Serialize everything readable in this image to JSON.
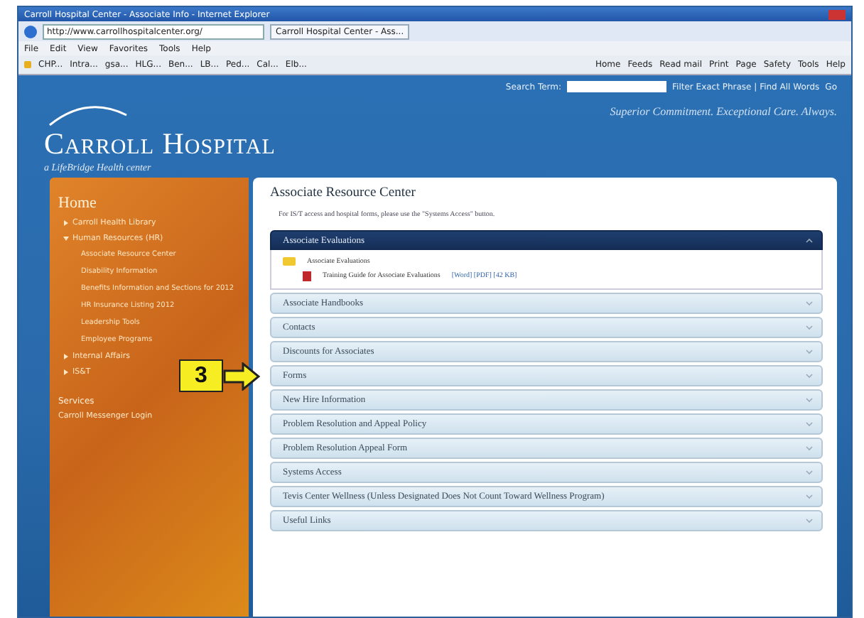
{
  "browser": {
    "title": "Carroll Hospital Center - Associate Info - Internet Explorer",
    "address": "http://www.carrollhospitalcenter.org/",
    "tab": "Carroll Hospital Center - Ass...",
    "menu": [
      "File",
      "Edit",
      "View",
      "Favorites",
      "Tools",
      "Help"
    ],
    "favorites": [
      "CHP...",
      "Intra...",
      "gsa...",
      "HLG...",
      "Ben...",
      "LB...",
      "Ped...",
      "Cal...",
      "Elb..."
    ],
    "commands": [
      "Home",
      "Feeds",
      "Read mail",
      "Print",
      "Page",
      "Safety",
      "Tools",
      "Help"
    ]
  },
  "header": {
    "search_label": "Search Term:",
    "search_options": "Filter Exact Phrase | Find All Words",
    "go": "Go",
    "logo": "Carroll Hospital",
    "logo_sub": "a LifeBridge Health center",
    "tagline": "Superior Commitment. Exceptional Care. Always."
  },
  "sidebar": {
    "title": "Home",
    "items": [
      {
        "label": "Carroll Health Library",
        "expanded": false
      },
      {
        "label": "Human Resources (HR)",
        "expanded": true,
        "children": [
          {
            "label": "Associate Resource Center"
          },
          {
            "label": "Disability Information"
          },
          {
            "label": "Benefits Information and Sections for 2012"
          },
          {
            "label": "HR Insurance Listing 2012"
          },
          {
            "label": "Leadership Tools"
          },
          {
            "label": "Employee Programs"
          }
        ]
      },
      {
        "label": "Internal Affairs",
        "expanded": false
      },
      {
        "label": "IS&T",
        "expanded": false
      }
    ],
    "section": "Services",
    "link": "Carroll Messenger Login"
  },
  "content": {
    "title": "Associate Resource Center",
    "note": "For IS/T access and hospital forms, please use the \"Systems Access\" button.",
    "sections": [
      {
        "title": "Associate Evaluations",
        "expanded": true,
        "folder": "Associate Evaluations",
        "file": "Training Guide for Associate Evaluations",
        "file_info": "[Word] [PDF] [42 KB]"
      },
      {
        "title": "Associate Handbooks",
        "expanded": false
      },
      {
        "title": "Contacts",
        "expanded": false
      },
      {
        "title": "Discounts for Associates",
        "expanded": false
      },
      {
        "title": "Forms",
        "expanded": false,
        "callout": "3"
      },
      {
        "title": "New Hire Information",
        "expanded": false
      },
      {
        "title": "Problem Resolution and Appeal Policy",
        "expanded": false
      },
      {
        "title": "Problem Resolution Appeal Form",
        "expanded": false
      },
      {
        "title": "Systems Access",
        "expanded": false
      },
      {
        "title": "Tevis Center Wellness (Unless Designated Does Not Count Toward Wellness Program)",
        "expanded": false
      },
      {
        "title": "Useful Links",
        "expanded": false
      }
    ]
  }
}
